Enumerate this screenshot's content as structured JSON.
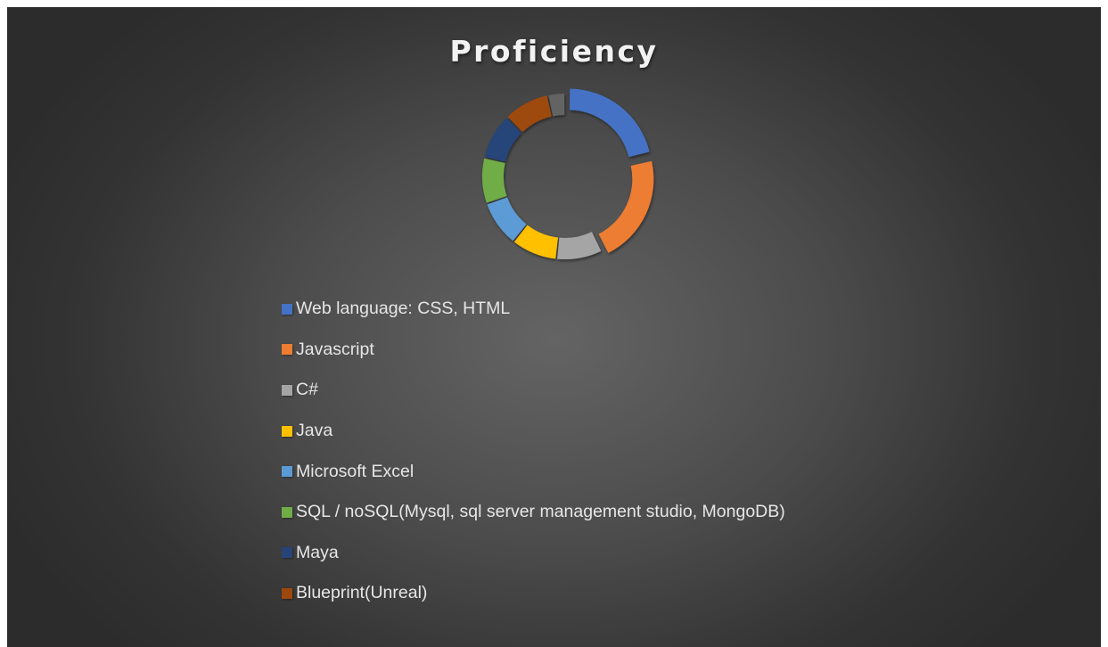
{
  "chart_data": {
    "type": "pie",
    "variant": "donut",
    "title": "Proficiency",
    "categories": [
      "Web language: CSS, HTML",
      "Javascript",
      "C#",
      "Java",
      "Microsoft Excel",
      "SQL / noSQL(Mysql, sql server management studio, MongoDB)",
      "Maya",
      "Blueprint(Unreal)",
      ""
    ],
    "values": [
      19,
      19,
      8,
      8,
      8,
      8,
      8,
      8,
      3
    ],
    "colors": [
      "#4472c4",
      "#ed7d31",
      "#a5a5a5",
      "#ffc000",
      "#5b9bd5",
      "#70ad47",
      "#264478",
      "#9e480e",
      "#636363"
    ],
    "exploded_slices": [
      0,
      1
    ],
    "legend_position": "bottom"
  }
}
